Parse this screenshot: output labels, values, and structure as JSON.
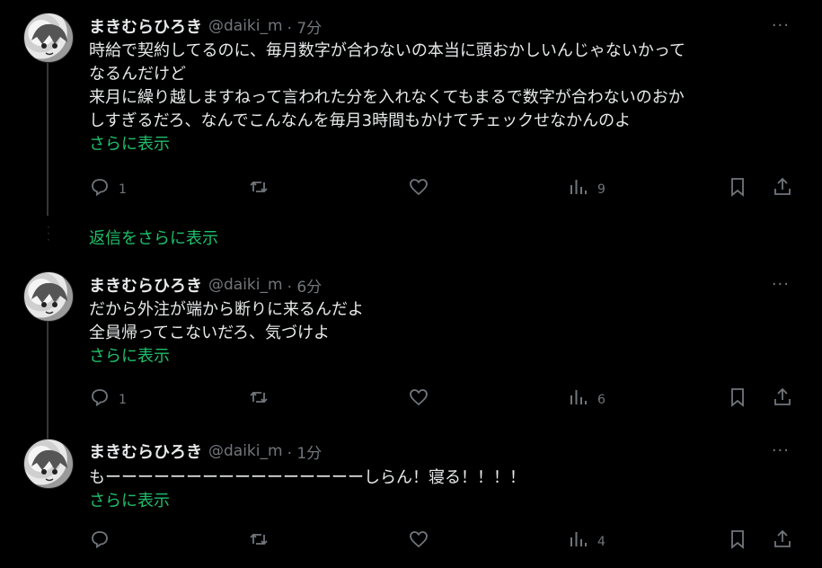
{
  "tweets": [
    {
      "name": "まきむらひろき",
      "handle": "@daiki_m",
      "time": "· 7分",
      "lines": [
        "時給で契約してるのに、毎月数字が合わないの本当に頭おかしいんじゃないかって",
        "なるんだけど",
        "来月に繰り越しますねって言われた分を入れなくてもまるで数字が合わないのおか",
        "しすぎるだろ、なんでこんなんを毎月3時間もかけてチェックせなかんのよ"
      ],
      "show_more": "さらに表示",
      "reply_count": "1",
      "views": "9"
    },
    {
      "name": "まきむらひろき",
      "handle": "@daiki_m",
      "time": "· 6分",
      "lines": [
        "だから外注が端から断りに来るんだよ",
        "全員帰ってこないだろ、気づけよ"
      ],
      "show_more": "さらに表示",
      "reply_count": "1",
      "views": "6"
    },
    {
      "name": "まきむらひろき",
      "handle": "@daiki_m",
      "time": "· 1分",
      "lines": [
        "もーーーーーーーーーーーーーーーーしらん！寝る！！！！"
      ],
      "show_more": "さらに表示",
      "reply_count": "",
      "views": "4"
    }
  ],
  "more_replies": "返信をさらに表示",
  "more_menu": "···",
  "icons": [
    "reply-icon",
    "retweet-icon",
    "like-icon",
    "views-icon",
    "bookmark-icon",
    "share-icon"
  ]
}
